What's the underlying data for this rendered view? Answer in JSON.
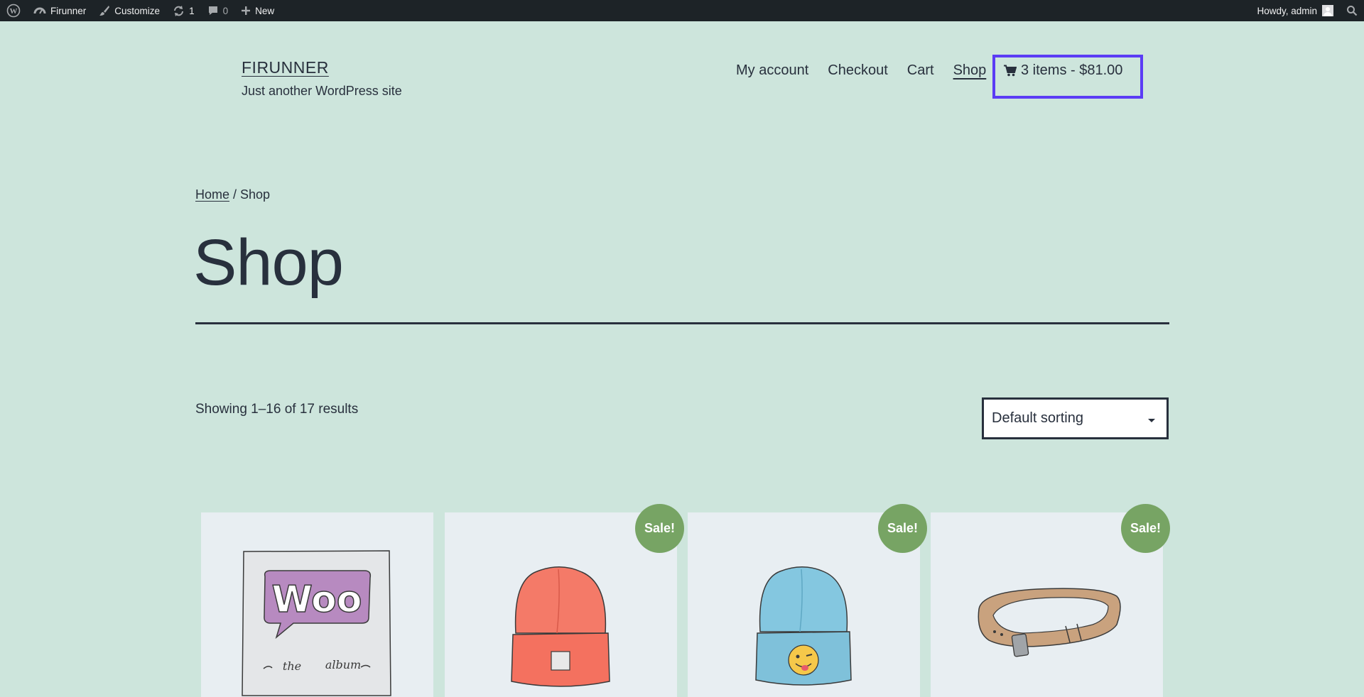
{
  "admin_bar": {
    "site_name": "Firunner",
    "customize": "Customize",
    "updates_count": "1",
    "comments_count": "0",
    "new_label": "New",
    "greeting": "Howdy, admin"
  },
  "header": {
    "site_title": "FIRUNNER",
    "tagline": "Just another WordPress site",
    "nav": [
      {
        "label": "My account"
      },
      {
        "label": "Checkout"
      },
      {
        "label": "Cart"
      },
      {
        "label": "Shop",
        "current": true
      }
    ],
    "cart_summary": "3 items - $81.00",
    "highlight_color": "#5b3cf5"
  },
  "breadcrumb": {
    "home": "Home",
    "separator": " / ",
    "current": "Shop"
  },
  "page": {
    "title": "Shop",
    "result_count": "Showing 1–16 of 17 results",
    "sorting_selected": "Default sorting"
  },
  "products": [
    {
      "icon": "woo-album-image",
      "sale": false
    },
    {
      "icon": "red-beanie-image",
      "sale": true
    },
    {
      "icon": "blue-beanie-image",
      "sale": true
    },
    {
      "icon": "belt-image",
      "sale": true
    }
  ],
  "sale_label": "Sale!",
  "colors": {
    "background": "#cde5dc",
    "admin_bar": "#1d2327",
    "text": "#28303d",
    "sale_badge": "#77a464",
    "product_bg": "#e8eef2"
  }
}
